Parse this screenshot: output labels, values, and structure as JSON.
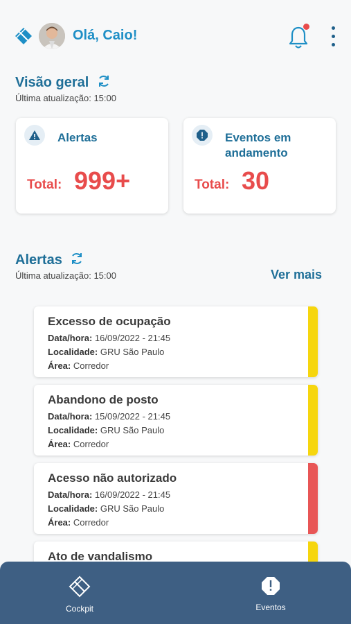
{
  "header": {
    "greeting": "Olá, Caio!",
    "logo_icon": "diamond-logo-icon",
    "avatar_icon": "user-avatar",
    "notification_icon": "bell-icon",
    "notification_dot_color": "#e84c4c",
    "menu_icon": "kebab-menu-icon"
  },
  "overview": {
    "title": "Visão geral",
    "last_update": "Última atualização: 15:00",
    "cards": [
      {
        "icon": "warning-triangle-icon",
        "title": "Alertas",
        "total_label": "Total:",
        "total_value": "999+"
      },
      {
        "icon": "alert-octagon-icon",
        "title_line1": "Eventos em",
        "title_line2": "andamento",
        "total_label": "Total:",
        "total_value": "30"
      }
    ]
  },
  "alerts": {
    "title": "Alertas",
    "last_update": "Última atualização: 15:00",
    "see_more": "Ver mais",
    "items": [
      {
        "title": "Excesso de ocupação",
        "datetime_label": "Data/hora:",
        "datetime": "16/09/2022 - 21:45",
        "location_label": "Localidade:",
        "location": "GRU São Paulo",
        "area_label": "Área:",
        "area": "Corredor",
        "severity_color": "#f6d60e"
      },
      {
        "title": "Abandono de posto",
        "datetime_label": "Data/hora:",
        "datetime": "15/09/2022 - 21:45",
        "location_label": "Localidade:",
        "location": "GRU São Paulo",
        "area_label": "Área:",
        "area": "Corredor",
        "severity_color": "#f6d60e"
      },
      {
        "title": "Acesso não autorizado",
        "datetime_label": "Data/hora:",
        "datetime": "16/09/2022 - 21:45",
        "location_label": "Localidade:",
        "location": "GRU São Paulo",
        "area_label": "Área:",
        "area": "Corredor",
        "severity_color": "#e85656"
      },
      {
        "title": "Ato de vandalismo",
        "severity_color": "#f6d60e"
      }
    ]
  },
  "bottom_nav": {
    "items": [
      {
        "label": "Cockpit",
        "icon": "cockpit-diamond-icon"
      },
      {
        "label": "Eventos",
        "icon": "alert-octagon-icon"
      }
    ]
  },
  "colors": {
    "primary": "#1e8fc6",
    "heading": "#1f6f98",
    "danger": "#e84c4c",
    "nav_bg": "#3e5f83"
  }
}
